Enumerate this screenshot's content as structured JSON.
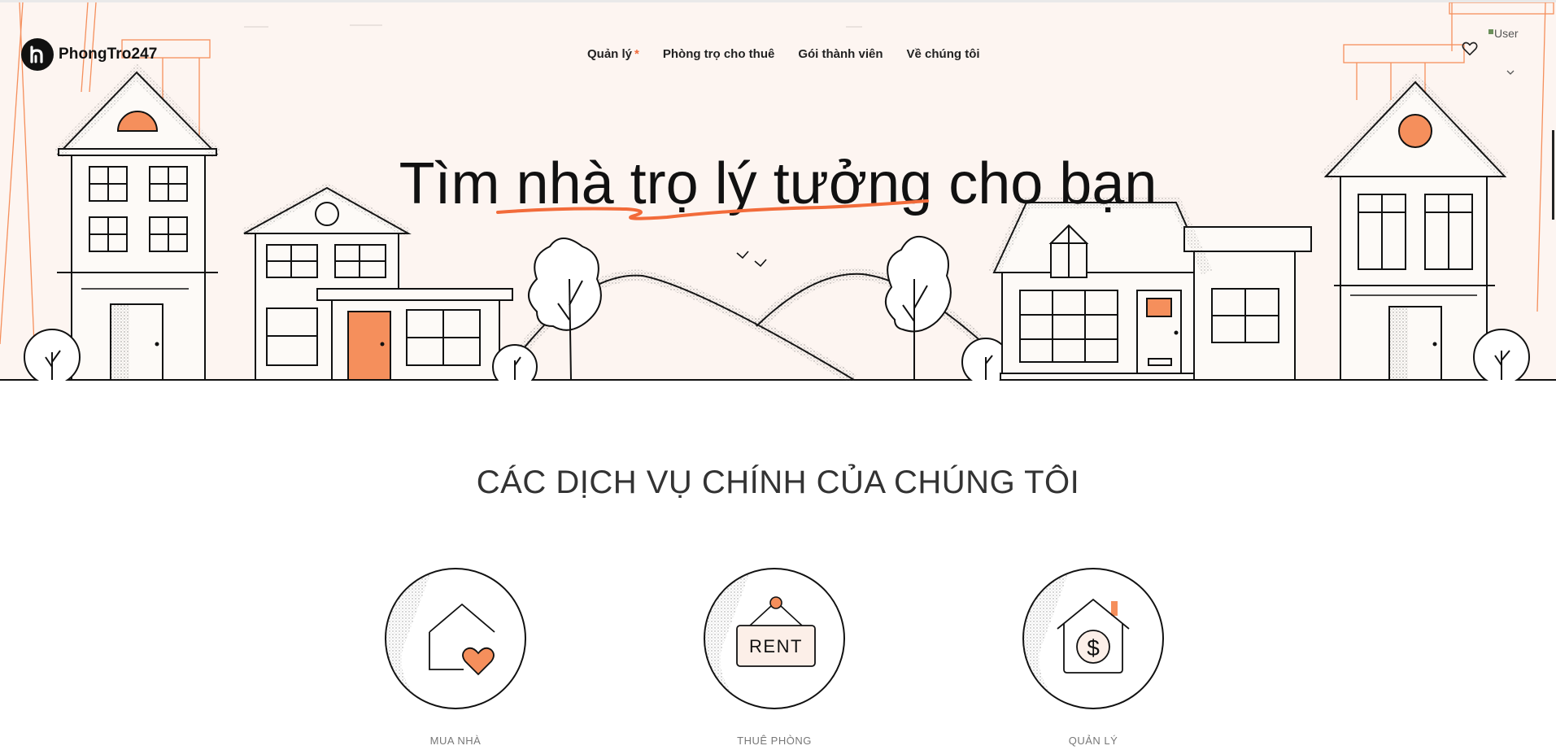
{
  "brand": {
    "name": "PhongTro247"
  },
  "nav": {
    "items": [
      {
        "label": "Quản lý",
        "marker": "*"
      },
      {
        "label": "Phòng trọ cho thuê"
      },
      {
        "label": "Gói thành viên"
      },
      {
        "label": "Về chúng tôi"
      }
    ]
  },
  "header": {
    "avatar_alt": "User"
  },
  "hero": {
    "title": "Tìm nhà trọ lý tưởng cho bạn"
  },
  "services": {
    "title": "CÁC DỊCH VỤ CHÍNH CỦA CHÚNG TÔI",
    "items": [
      {
        "label": "MUA NHÀ",
        "icon": "house-heart-icon"
      },
      {
        "label": "THUÊ PHÒNG",
        "icon": "rent-sign-icon",
        "sign_text": "RENT"
      },
      {
        "label": "QUẢN LÝ",
        "icon": "house-dollar-icon",
        "symbol": "$"
      }
    ]
  },
  "colors": {
    "accent": "#f58f5c",
    "hero_bg": "#fdf5f1",
    "line": "#111111",
    "orange_line": "#f26b3a"
  }
}
